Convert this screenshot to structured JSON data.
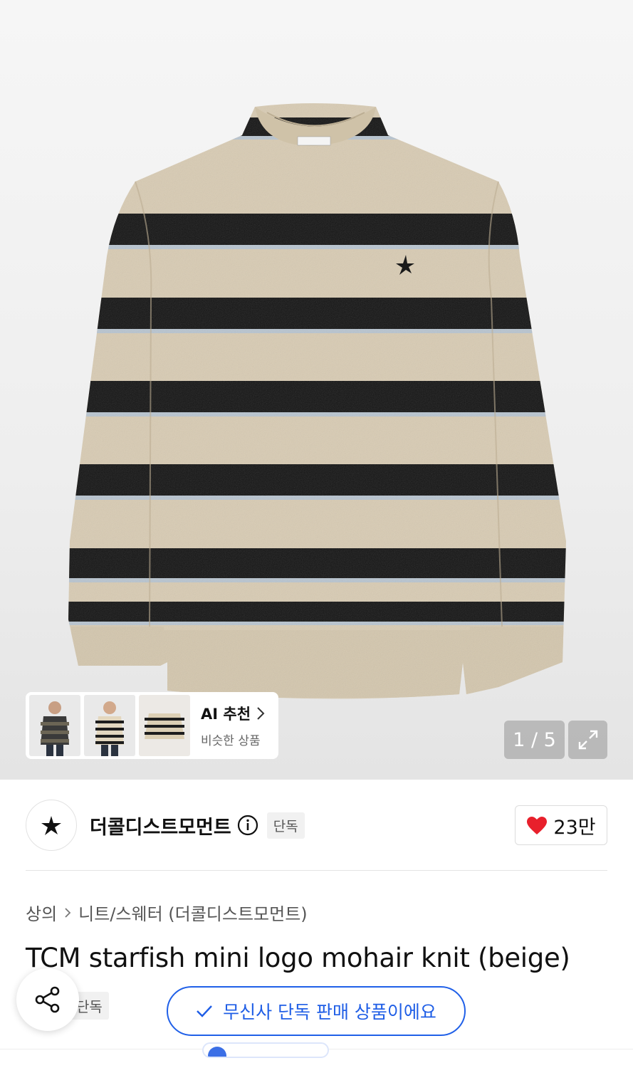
{
  "product_image": {
    "alt": "TCM starfish mini logo mohair knit (beige)",
    "counter": "1 / 5"
  },
  "recommend": {
    "title": "AI 추천",
    "subtitle": "비슷한 상품"
  },
  "brand": {
    "name": "더콜디스트모먼트",
    "badge": "단독",
    "likes": "23만"
  },
  "breadcrumb": {
    "category": "상의",
    "subcategory": "니트/스웨터 (더콜디스트모먼트)"
  },
  "product": {
    "title": "TCM starfish mini logo mohair knit (beige)",
    "tag": "단독"
  },
  "exclusive_notice": "무신사 단독 판매 상품이에요",
  "colors": {
    "accent": "#2060e8",
    "heart": "#e8202c",
    "sweater_beige": "#d8cbb3",
    "sweater_black": "#141414"
  },
  "icons": {
    "info": "info-icon",
    "expand": "expand-icon",
    "share": "share-icon",
    "heart": "heart-icon",
    "check": "check-icon",
    "chevron": "chevron-right-icon",
    "brand_logo": "starfish-logo-icon"
  }
}
